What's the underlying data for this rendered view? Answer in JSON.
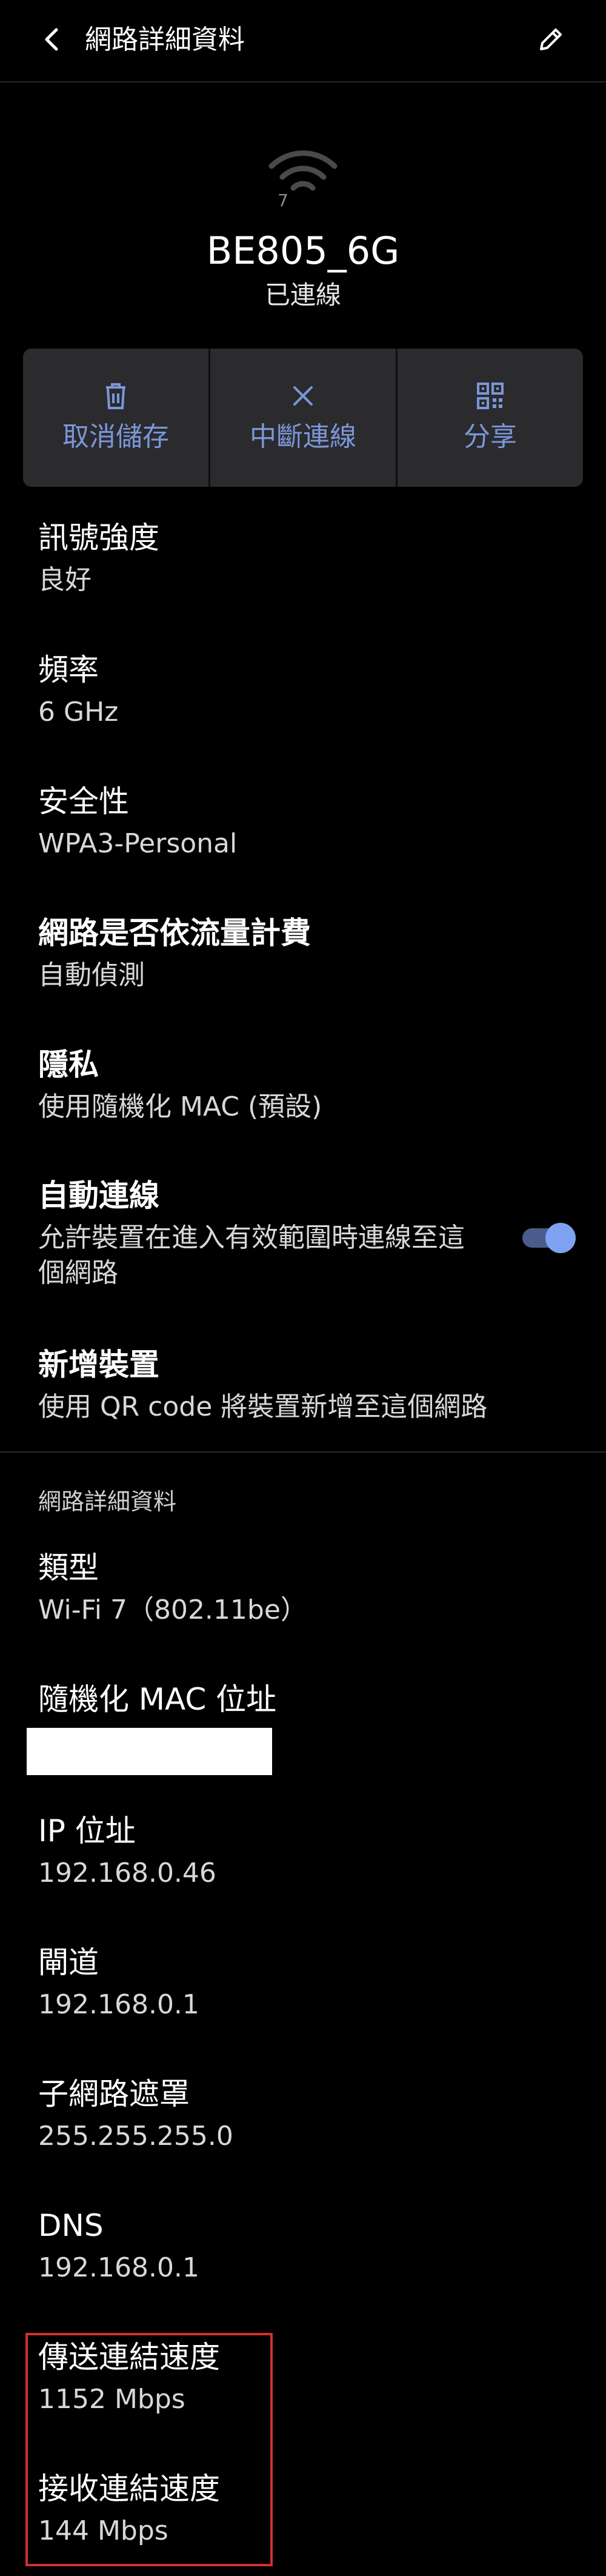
{
  "header": {
    "title": "網路詳細資料"
  },
  "network": {
    "name": "BE805_6G",
    "status": "已連線",
    "wifi_badge": "7"
  },
  "actions": [
    {
      "label": "取消儲存",
      "icon": "trash-icon"
    },
    {
      "label": "中斷連線",
      "icon": "close-icon"
    },
    {
      "label": "分享",
      "icon": "qr-code-icon"
    }
  ],
  "settings": {
    "signal": {
      "title": "訊號強度",
      "value": "良好"
    },
    "frequency": {
      "title": "頻率",
      "value": "6 GHz"
    },
    "security": {
      "title": "安全性",
      "value": "WPA3-Personal"
    },
    "metered": {
      "title": "網路是否依流量計費",
      "value": "自動偵測"
    },
    "privacy": {
      "title": "隱私",
      "value": "使用隨機化 MAC (預設)"
    },
    "auto_connect": {
      "title": "自動連線",
      "value": "允許裝置在進入有效範圍時連線至這個網路",
      "enabled": true
    },
    "add_device": {
      "title": "新增裝置",
      "value": "使用 QR code 將裝置新增至這個網路"
    }
  },
  "details": {
    "header": "網路詳細資料",
    "type": {
      "title": "類型",
      "value": "Wi-Fi 7（802.11be）"
    },
    "mac": {
      "title": "隨機化 MAC 位址"
    },
    "ip": {
      "title": "IP 位址",
      "value": "192.168.0.46"
    },
    "gateway": {
      "title": "閘道",
      "value": "192.168.0.1"
    },
    "subnet": {
      "title": "子網路遮罩",
      "value": "255.255.255.0"
    },
    "dns": {
      "title": "DNS",
      "value": "192.168.0.1"
    },
    "tx_speed": {
      "title": "傳送連結速度",
      "value": "1152 Mbps"
    },
    "rx_speed": {
      "title": "接收連結速度",
      "value": "144 Mbps"
    }
  },
  "colors": {
    "background": "#000000",
    "accent": "#7b97d9",
    "card": "#2b2b2e",
    "highlight": "#d32f2f"
  }
}
